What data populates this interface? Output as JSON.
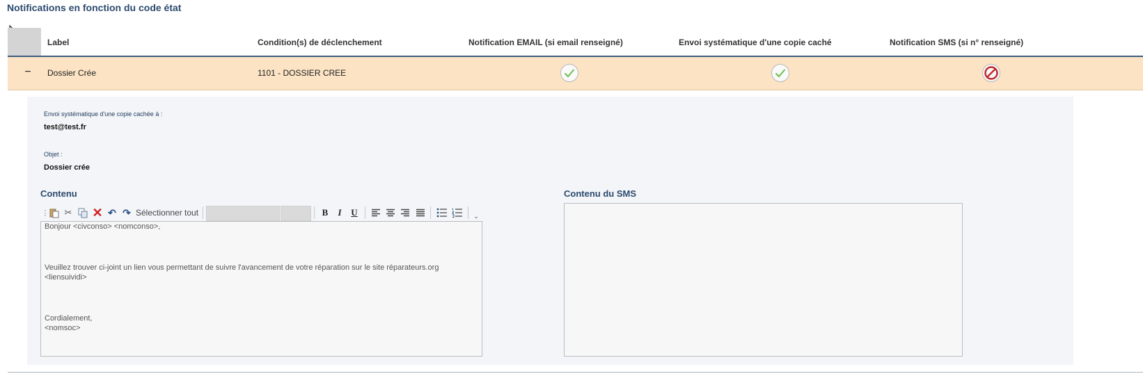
{
  "section_title": "Notifications en fonction du code état",
  "table": {
    "headers": {
      "label": "Label",
      "condition": "Condition(s) de déclenchement",
      "email": "Notification EMAIL (si email renseigné)",
      "bcc": "Envoi systématique d'une copie caché",
      "sms": "Notification SMS (si n° renseigné)"
    },
    "row": {
      "collapse_symbol": "−",
      "label": "Dossier Crée",
      "condition": "1101 - DOSSIER CREE",
      "email_status": "check-icon",
      "bcc_status": "check-icon",
      "sms_status": "forbidden-icon"
    }
  },
  "detail": {
    "bcc_label": "Envoi systématique d'une copie cachée à :",
    "bcc_value": "test@test.fr",
    "subject_label": "Objet :",
    "subject_value": "Dossier crée",
    "content_title": "Contenu",
    "sms_title": "Contenu du SMS",
    "toolbar": {
      "select_all": "Sélectionner tout"
    },
    "editor_lines": {
      "l1": "Bonjour <civconso> <nomconso>,",
      "l2": "Veuillez trouver ci-joint un lien vous permettant de suivre l'avancement de votre réparation sur le site réparateurs.org",
      "l3": "<liensuividi>",
      "l4": "Cordialement,",
      "l5": "<nomsoc>"
    }
  },
  "colors": {
    "accent": "#2c4a6e",
    "row_highlight": "#fbe3c4",
    "check": "#6bbf4a",
    "forbidden": "#c0282e"
  }
}
